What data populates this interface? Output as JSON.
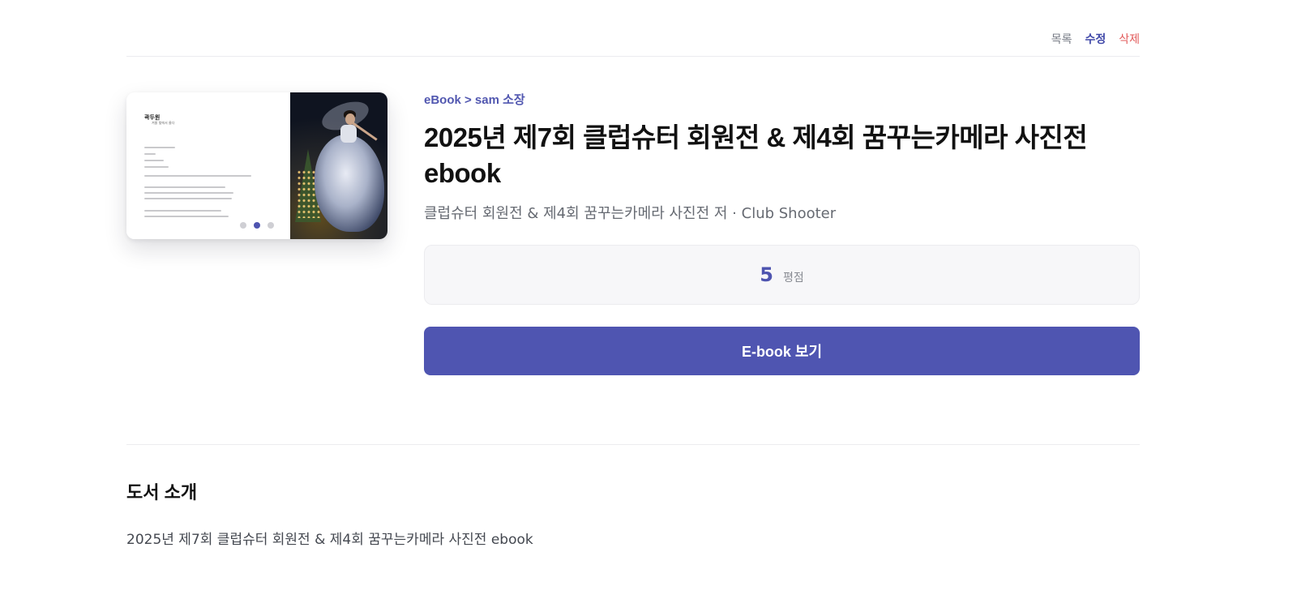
{
  "actions": {
    "list_label": "목록",
    "edit_label": "수정",
    "delete_label": "삭제"
  },
  "cover": {
    "page_title": "곽두원",
    "page_subtitle": "겨울 빛에서 울다",
    "carousel": {
      "total": 3,
      "active_index": 2
    }
  },
  "book": {
    "breadcrumb": "eBook > sam 소장",
    "title": "2025년 제7회 클럽슈터 회원전 & 제4회 꿈꾸는카메라 사진전 ebook",
    "author_line": "클럽슈터 회원전 & 제4회 꿈꾸는카메라 사진전 저 · Club Shooter"
  },
  "rating": {
    "value": "5",
    "label": "평점"
  },
  "view_button_label": "E-book 보기",
  "intro": {
    "heading": "도서 소개",
    "text": "2025년 제7회 클럽슈터 회원전 & 제4회 꿈꾸는카메라 사진전 ebook"
  },
  "colors": {
    "accent": "#4f55b1",
    "delete": "#e25a5a",
    "muted": "#777b85"
  }
}
